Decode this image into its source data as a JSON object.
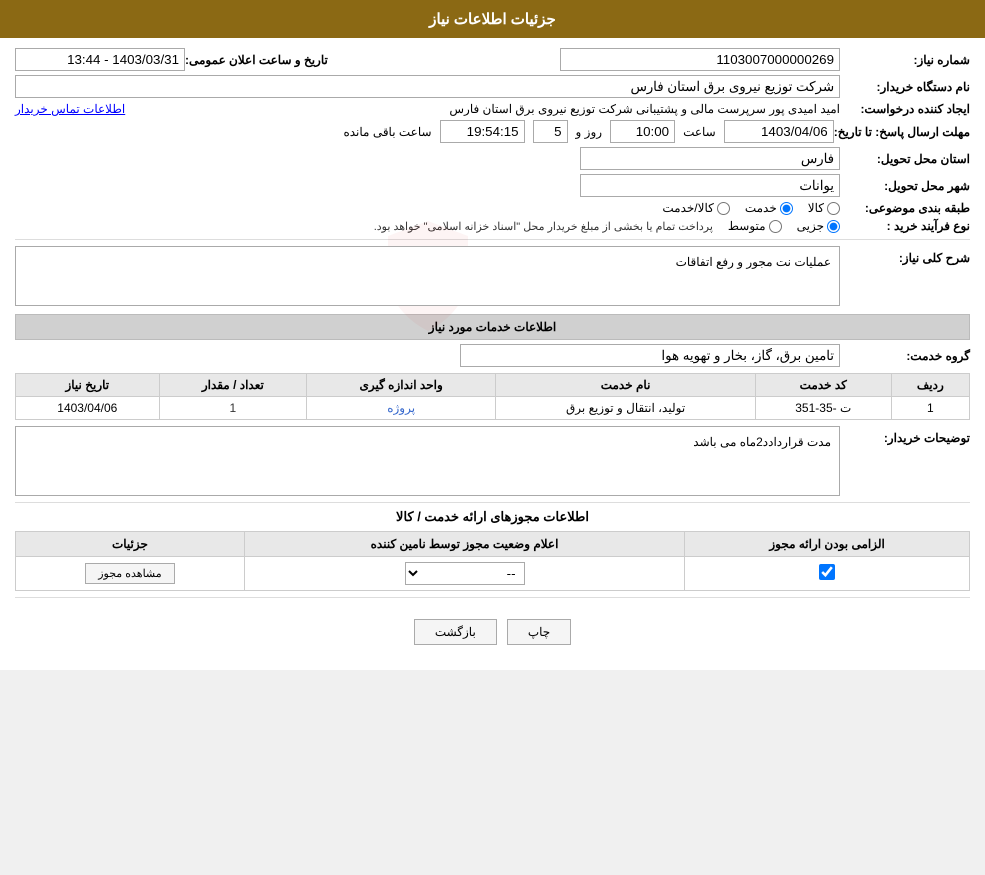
{
  "header": {
    "title": "جزئیات اطلاعات نیاز"
  },
  "fields": {
    "need_number_label": "شماره نیاز:",
    "need_number_value": "1103007000000269",
    "buyer_org_label": "نام دستگاه خریدار:",
    "buyer_org_value": "شرکت توزیع نیروی برق استان فارس",
    "announce_date_label": "تاریخ و ساعت اعلان عمومی:",
    "announce_date_value": "1403/03/31 - 13:44",
    "creator_label": "ایجاد کننده درخواست:",
    "creator_value": "امید امیدی پور سرپرست مالی و پشتیبانی  شرکت توزیع نیروی برق استان فارس",
    "contact_link": "اطلاعات تماس خریدار",
    "deadline_label": "مهلت ارسال پاسخ: تا تاریخ:",
    "deadline_date": "1403/04/06",
    "deadline_time_label": "ساعت",
    "deadline_time": "10:00",
    "deadline_days_label": "روز و",
    "deadline_days": "5",
    "deadline_countdown_label": "ساعت باقی مانده",
    "deadline_countdown": "19:54:15",
    "province_label": "استان محل تحویل:",
    "province_value": "فارس",
    "city_label": "شهر محل تحویل:",
    "city_value": "یوانات",
    "category_label": "طبقه بندی موضوعی:",
    "category_radio_kala": "کالا",
    "category_radio_khedmat": "خدمت",
    "category_radio_kala_khedmat": "کالا/خدمت",
    "category_selected": "khedmat",
    "purchase_type_label": "نوع فرآیند خرید :",
    "purchase_type_jozyi": "جزیی",
    "purchase_type_mutavasset": "متوسط",
    "purchase_type_notice": "پرداخت تمام یا بخشی از مبلغ خریدار محل \"اسناد خزانه اسلامی\" خواهد بود.",
    "purchase_type_selected": "jozyi",
    "general_desc_label": "شرح کلی نیاز:",
    "general_desc_value": "عملیات نت مجور و رفع اتفاقات",
    "services_section_label": "اطلاعات خدمات مورد نیاز",
    "service_group_label": "گروه خدمت:",
    "service_group_value": "تامین برق، گاز، بخار و تهویه هوا",
    "table_headers": {
      "row_num": "ردیف",
      "service_code": "کد خدمت",
      "service_name": "نام خدمت",
      "unit": "واحد اندازه گیری",
      "quantity": "تعداد / مقدار",
      "need_date": "تاریخ نیاز"
    },
    "table_rows": [
      {
        "row_num": "1",
        "service_code": "ت -35-351",
        "service_name": "تولید، انتقال و توزیع برق",
        "unit": "پروژه",
        "quantity": "1",
        "need_date": "1403/04/06"
      }
    ],
    "buyer_desc_label": "توضیحات خریدار:",
    "buyer_desc_value": "مدت قراردادد2ماه می باشد",
    "license_section_label": "اطلاعات مجوزهای ارائه خدمت / کالا",
    "license_table_headers": {
      "required": "الزامی بودن ارائه مجوز",
      "status_announce": "اعلام وضعیت مجوز توسط نامین کننده",
      "details": "جزئیات"
    },
    "license_rows": [
      {
        "required": true,
        "status": "--",
        "details_btn": "مشاهده مجوز"
      }
    ]
  },
  "buttons": {
    "print": "چاپ",
    "back": "بازگشت"
  }
}
